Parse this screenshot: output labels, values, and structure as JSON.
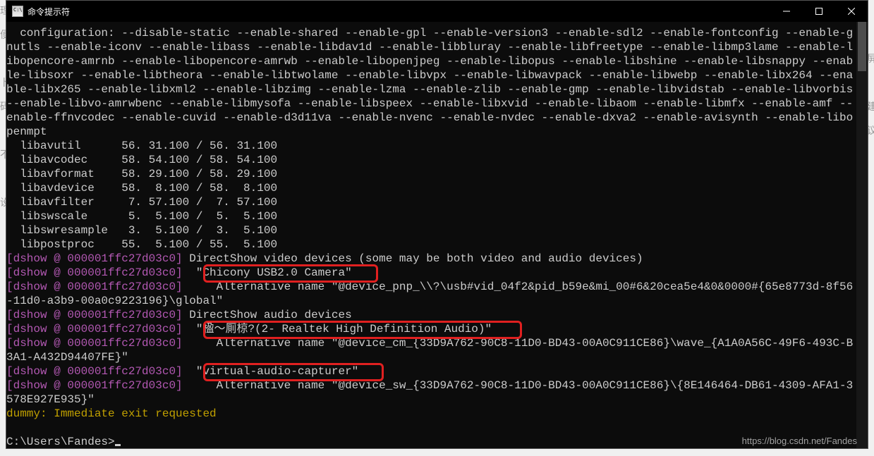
{
  "window": {
    "title": "命令提示符",
    "icon_name": "cmd-icon"
  },
  "configuration": "  configuration: --disable-static --enable-shared --enable-gpl --enable-version3 --enable-sdl2 --enable-fontconfig --enable-gnutls --enable-iconv --enable-libass --enable-libdav1d --enable-libbluray --enable-libfreetype --enable-libmp3lame --enable-libopencore-amrnb --enable-libopencore-amrwb --enable-libopenjpeg --enable-libopus --enable-libshine --enable-libsnappy --enable-libsoxr --enable-libtheora --enable-libtwolame --enable-libvpx --enable-libwavpack --enable-libwebp --enable-libx264 --enable-libx265 --enable-libxml2 --enable-libzimg --enable-lzma --enable-zlib --enable-gmp --enable-libvidstab --enable-libvorbis --enable-libvo-amrwbenc --enable-libmysofa --enable-libspeex --enable-libxvid --enable-libaom --enable-libmfx --enable-amf --enable-ffnvcodec --enable-cuvid --enable-d3d11va --enable-nvenc --enable-nvdec --enable-dxva2 --enable-avisynth --enable-libopenmpt",
  "libs": [
    "  libavutil      56. 31.100 / 56. 31.100",
    "  libavcodec     58. 54.100 / 58. 54.100",
    "  libavformat    58. 29.100 / 58. 29.100",
    "  libavdevice    58.  8.100 / 58.  8.100",
    "  libavfilter     7. 57.100 /  7. 57.100",
    "  libswscale      5.  5.100 /  5.  5.100",
    "  libswresample   3.  5.100 /  3.  5.100",
    "  libpostproc    55.  5.100 / 55.  5.100"
  ],
  "dshow": {
    "tag": "[dshow @ 000001ffc27d03c0]",
    "video_header_a": " DirectShow video devices ",
    "video_header_b": "(some may be both video and audio devices)",
    "video_device": "  \"Chicony USB2.0 Camera\"",
    "video_alt_a": "     Alternative name ",
    "video_alt_b": "\"@device_pnp_\\\\?\\usb#vid_04f2&pid_b59e&mi_00#6&20cea5e4&0&0000#{65e8773d-8f56-11d0-a3b9-00a0c9223196}\\global\"",
    "audio_header": " DirectShow audio devices",
    "audio_device": "  \"楹〜厠椋?(2- Realtek High Definition Audio)\"",
    "audio_alt_a": "     Alternative name ",
    "audio_alt_b": "\"@device_cm_{33D9A762-90C8-11D0-BD43-00A0C911CE86}\\wave_{A1A0A56C-49F6-493C-B3A1-A432D94407FE}\"",
    "vac_device": "  \"virtual-audio-capturer\"",
    "vac_alt_a": "     Alternative name ",
    "vac_alt_b": "\"@device_sw_{33D9A762-90C8-11D0-BD43-00A0C911CE86}\\{8E146464-DB61-4309-AFA1-3578E927E935}\""
  },
  "dummy_line": "dummy: Immediate exit requested",
  "prompt": "C:\\Users\\Fandes>",
  "watermark": "https://blog.csdn.net/Fandes",
  "colors": {
    "bg": "#0c0c0c",
    "fg": "#cccccc",
    "tag": "#b358b3",
    "warn": "#c0a000",
    "anno": "#e02020"
  }
}
